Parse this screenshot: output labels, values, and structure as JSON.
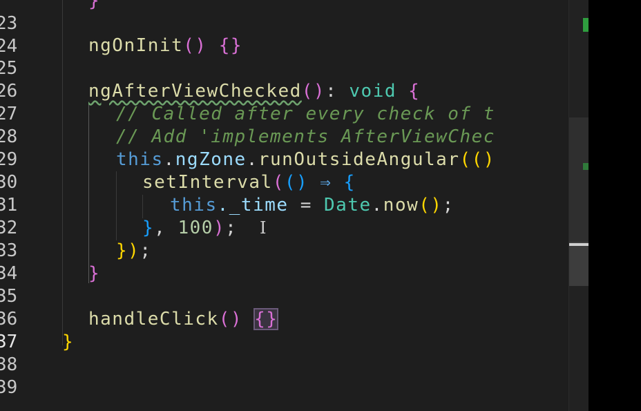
{
  "editor": {
    "lines": [
      {
        "num": "23",
        "text": "}"
      },
      {
        "num": "24"
      },
      {
        "num": "25",
        "text": "ngOnInit() {}"
      },
      {
        "num": "26"
      },
      {
        "num": "27",
        "text": "ngAfterViewChecked(): void {"
      },
      {
        "num": "28",
        "text": "// Called after every check of t"
      },
      {
        "num": "29",
        "text": "// Add 'implements AfterViewChec"
      },
      {
        "num": "30",
        "text": "this.ngZone.runOutsideAngular(()"
      },
      {
        "num": "31",
        "text": "setInterval(() ⇒ {"
      },
      {
        "num": "32",
        "text": "this._time = Date.now();"
      },
      {
        "num": "33",
        "text": "}, 100);"
      },
      {
        "num": "34",
        "text": "});"
      },
      {
        "num": "35",
        "text": "}"
      },
      {
        "num": "36"
      },
      {
        "num": "37",
        "text": "handleClick() {}"
      },
      {
        "num": "38",
        "text": "}"
      },
      {
        "num": "39"
      }
    ],
    "tokens": {
      "l23_brace": "}",
      "l25_fn": "ngOnInit",
      "l25_paren": "()",
      "l25_brace": "{}",
      "l27_fn": "ngAfterViewChecked",
      "l27_paren": "()",
      "l27_colon": ": ",
      "l27_type": "void",
      "l27_brace": " {",
      "l28_comment": "// Called after every check of t",
      "l29_comment": "// Add 'implements AfterViewChec",
      "l30_this": "this",
      "l30_dot1": ".",
      "l30_zone": "ngZone",
      "l30_dot2": ".",
      "l30_fn": "runOutsideAngular",
      "l30_paren_open": "(",
      "l30_inner": "()",
      "l31_fn": "setInterval",
      "l31_paren_open": "(",
      "l31_inner": "()",
      "l31_arrow": " ⇒ ",
      "l31_brace": "{",
      "l32_this": "this",
      "l32_prop": "._time",
      "l32_eq": " = ",
      "l32_cls": "Date",
      "l32_dot": ".",
      "l32_fn": "now",
      "l32_paren": "()",
      "l32_semi": ";",
      "l33_brace": "}",
      "l33_comma": ", ",
      "l33_num": "100",
      "l33_paren": ")",
      "l33_semi": ";",
      "l34_brace": "}",
      "l34_paren": ")",
      "l34_semi": ";",
      "l35_brace": "}",
      "l37_fn": "handleClick",
      "l37_paren": "()",
      "l37_brace": "{}",
      "l38_brace": "}"
    },
    "cursor_glyph": "I"
  }
}
